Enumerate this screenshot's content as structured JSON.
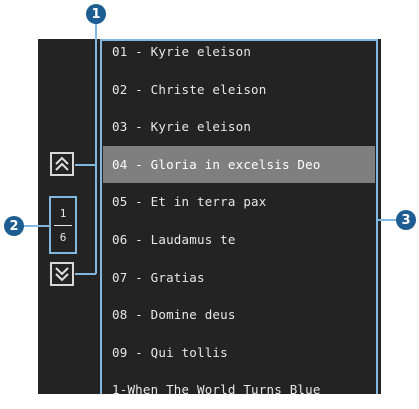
{
  "callouts": {
    "c1": "1",
    "c2": "2",
    "c3": "3"
  },
  "pager": {
    "current": "1",
    "total": "6"
  },
  "tracks": [
    "01 - Kyrie eleison",
    "02 - Christe eleison",
    "03 - Kyrie eleison",
    "04 - Gloria in excelsis Deo",
    "05 - Et in terra pax",
    "06 - Laudamus te",
    "07 - Gratias",
    "08 - Domine deus",
    "09 - Qui tollis",
    "1-When The World Turns Blue"
  ],
  "colors": {
    "highlight": "#7f7f7f",
    "callout": "#82b7e0",
    "badge": "#1e5d92"
  },
  "icons": {
    "page_up": "double-chevron-up-icon",
    "page_down": "double-chevron-down-icon"
  }
}
